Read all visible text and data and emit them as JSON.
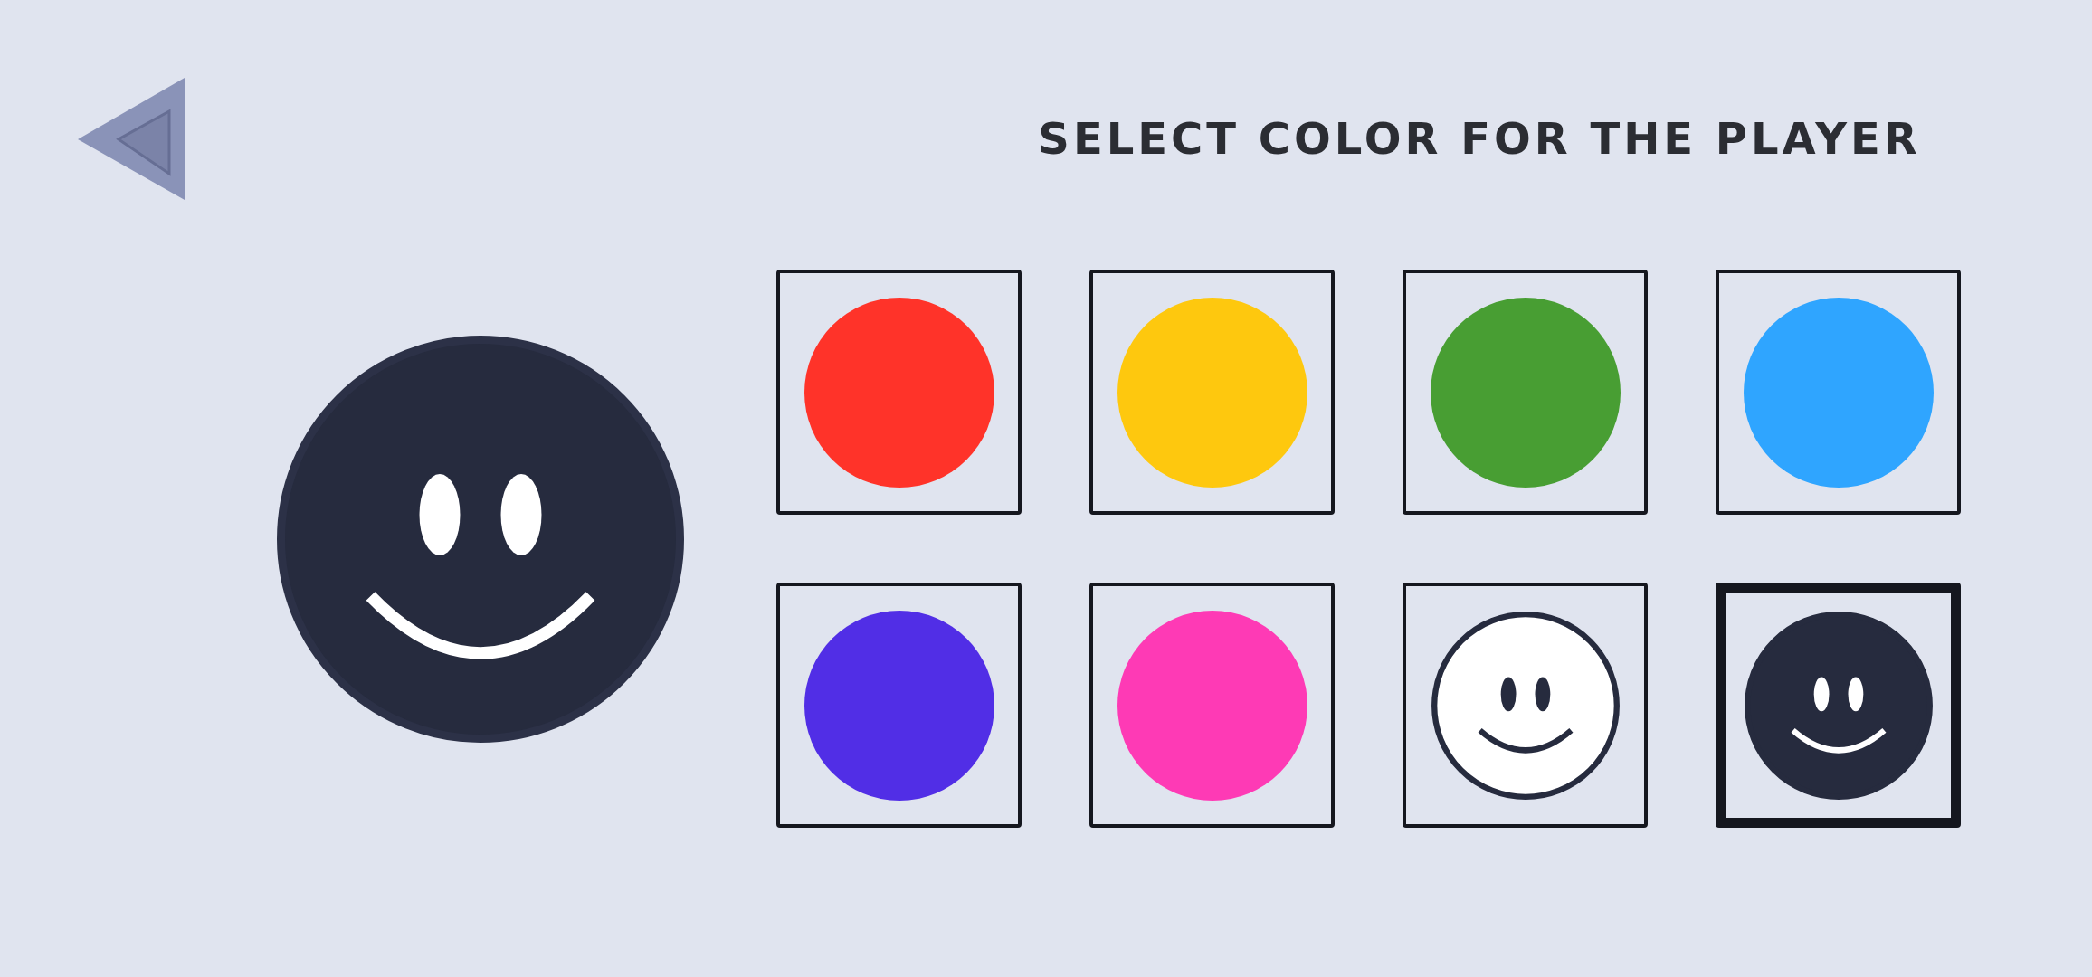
{
  "title": "SELECT COLOR FOR THE PLAYER",
  "swatches": [
    {
      "kind": "solid",
      "color": "#ff3329",
      "selected": false
    },
    {
      "kind": "solid",
      "color": "#fec80e",
      "selected": false
    },
    {
      "kind": "solid",
      "color": "#489e33",
      "selected": false
    },
    {
      "kind": "solid",
      "color": "#2fa5ff",
      "selected": false
    },
    {
      "kind": "solid",
      "color": "#512ee6",
      "selected": false
    },
    {
      "kind": "solid",
      "color": "#fe3ab5",
      "selected": false
    },
    {
      "kind": "face",
      "color": "#ffffff",
      "selected": false
    },
    {
      "kind": "face",
      "color": "#262b3e",
      "selected": true
    }
  ]
}
